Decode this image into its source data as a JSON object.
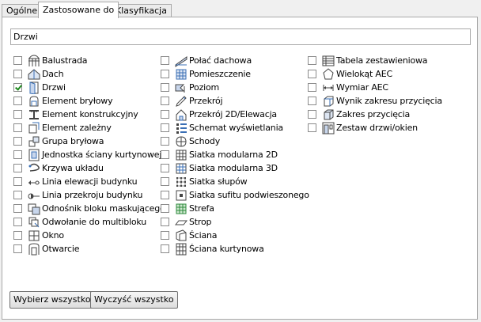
{
  "tabs": [
    {
      "label": "Ogólne"
    },
    {
      "label": "Zastosowane do"
    },
    {
      "label": "Klasyfikacja"
    }
  ],
  "name_value": "Drzwi",
  "columns": [
    [
      {
        "label": "Balustrada",
        "checked": false,
        "icon": "railing-icon"
      },
      {
        "label": "Dach",
        "checked": false,
        "icon": "roof-icon"
      },
      {
        "label": "Drzwi",
        "checked": true,
        "icon": "door-icon"
      },
      {
        "label": "Element bryłowy",
        "checked": false,
        "icon": "mass-element-icon"
      },
      {
        "label": "Element konstrukcyjny",
        "checked": false,
        "icon": "structural-member-icon"
      },
      {
        "label": "Element zależny",
        "checked": false,
        "icon": "dependent-element-icon"
      },
      {
        "label": "Grupa bryłowa",
        "checked": false,
        "icon": "mass-group-icon"
      },
      {
        "label": "Jednostka ściany kurtynowej",
        "checked": false,
        "icon": "curtain-wall-unit-icon"
      },
      {
        "label": "Krzywa układu",
        "checked": false,
        "icon": "layout-curve-icon"
      },
      {
        "label": "Linia elewacji budynku",
        "checked": false,
        "icon": "elevation-line-icon"
      },
      {
        "label": "Linia przekroju budynku",
        "checked": false,
        "icon": "section-line-icon"
      },
      {
        "label": "Odnośnik bloku maskującego",
        "checked": false,
        "icon": "mask-block-reference-icon"
      },
      {
        "label": "Odwołanie do multibloku",
        "checked": false,
        "icon": "multiblock-reference-icon"
      },
      {
        "label": "Okno",
        "checked": false,
        "icon": "window-icon"
      },
      {
        "label": "Otwarcie",
        "checked": false,
        "icon": "opening-icon"
      }
    ],
    [
      {
        "label": "Połać dachowa",
        "checked": false,
        "icon": "roof-slab-icon"
      },
      {
        "label": "Pomieszczenie",
        "checked": false,
        "icon": "space-icon"
      },
      {
        "label": "Poziom",
        "checked": false,
        "icon": "level-icon"
      },
      {
        "label": "Przekrój",
        "checked": false,
        "icon": "section-icon"
      },
      {
        "label": "Przekrój 2D/Elewacja",
        "checked": false,
        "icon": "section-2d-icon"
      },
      {
        "label": "Schemat wyświetlania",
        "checked": false,
        "icon": "display-theme-icon"
      },
      {
        "label": "Schody",
        "checked": false,
        "icon": "stair-icon"
      },
      {
        "label": "Siatka modularna 2D",
        "checked": false,
        "icon": "grid-2d-icon"
      },
      {
        "label": "Siatka modularna 3D",
        "checked": false,
        "icon": "grid-3d-icon"
      },
      {
        "label": "Siatka słupów",
        "checked": false,
        "icon": "column-grid-icon"
      },
      {
        "label": "Siatka sufitu podwieszonego",
        "checked": false,
        "icon": "ceiling-grid-icon"
      },
      {
        "label": "Strefa",
        "checked": false,
        "icon": "zone-icon"
      },
      {
        "label": "Strop",
        "checked": false,
        "icon": "slab-icon"
      },
      {
        "label": "Ściana",
        "checked": false,
        "icon": "wall-icon"
      },
      {
        "label": "Ściana kurtynowa",
        "checked": false,
        "icon": "curtain-wall-icon"
      }
    ],
    [
      {
        "label": "Tabela zestawieniowa",
        "checked": false,
        "icon": "schedule-table-icon"
      },
      {
        "label": "Wielokąt AEC",
        "checked": false,
        "icon": "polygon-icon"
      },
      {
        "label": "Wymiar AEC",
        "checked": false,
        "icon": "dimension-icon"
      },
      {
        "label": "Wynik zakresu przycięcia",
        "checked": false,
        "icon": "clip-result-icon"
      },
      {
        "label": "Zakres przycięcia",
        "checked": false,
        "icon": "clip-volume-icon"
      },
      {
        "label": "Zestaw drzwi/okien",
        "checked": false,
        "icon": "door-window-assembly-icon"
      }
    ]
  ],
  "buttons": {
    "select_all": "Wybierz wszystko",
    "clear_all": "Wyczyść wszystko"
  },
  "colors": {
    "accent_check": "#1f8a1f",
    "icon_blue": "#3a6fb5",
    "icon_gray": "#555555"
  }
}
